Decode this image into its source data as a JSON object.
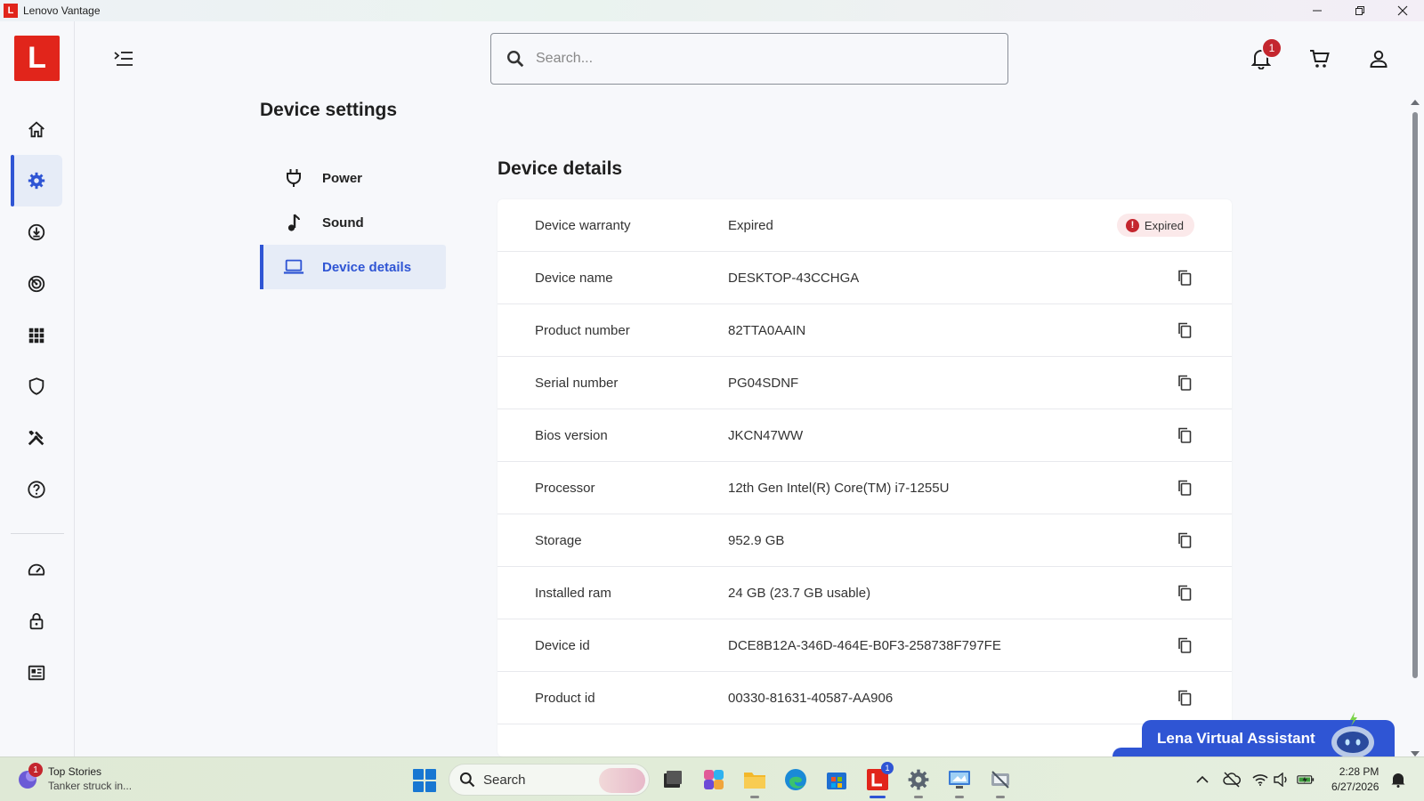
{
  "window": {
    "title": "Lenovo Vantage",
    "logo_letter": "L",
    "controls": [
      "minimize",
      "restore",
      "close"
    ]
  },
  "rail": {
    "brand_letter": "L",
    "items": [
      {
        "name": "home",
        "icon": "home-icon"
      },
      {
        "name": "device-settings",
        "icon": "gear-icon",
        "active": true
      },
      {
        "name": "system-update",
        "icon": "download-icon"
      },
      {
        "name": "smart-performance",
        "icon": "radar-icon"
      },
      {
        "name": "apps",
        "icon": "grid-icon"
      },
      {
        "name": "security",
        "icon": "shield-icon"
      },
      {
        "name": "tools",
        "icon": "tools-icon"
      },
      {
        "name": "help",
        "icon": "question-icon"
      },
      {
        "name": "dashboard",
        "icon": "speedometer-icon"
      },
      {
        "name": "privacy",
        "icon": "lock-icon"
      },
      {
        "name": "news",
        "icon": "news-icon"
      }
    ]
  },
  "header": {
    "search_placeholder": "Search...",
    "notification_count": "1"
  },
  "settings": {
    "title": "Device settings",
    "menu": [
      {
        "label": "Power",
        "icon": "plug-icon"
      },
      {
        "label": "Sound",
        "icon": "music-note-icon"
      },
      {
        "label": "Device details",
        "icon": "laptop-icon",
        "active": true
      }
    ]
  },
  "details": {
    "title": "Device details",
    "warranty": {
      "label": "Device warranty",
      "value": "Expired",
      "badge": "Expired"
    },
    "rows": [
      {
        "label": "Device name",
        "value": "DESKTOP-43CCHGA"
      },
      {
        "label": "Product number",
        "value": "82TTA0AAIN"
      },
      {
        "label": "Serial number",
        "value": "PG04SDNF"
      },
      {
        "label": "Bios version",
        "value": "JKCN47WW"
      },
      {
        "label": "Processor",
        "value": "12th Gen Intel(R) Core(TM) i7-1255U"
      },
      {
        "label": "Storage",
        "value": "952.9 GB"
      },
      {
        "label": "Installed ram",
        "value": "24 GB (23.7 GB usable)"
      },
      {
        "label": "Device id",
        "value": "DCE8B12A-346D-464E-B0F3-258738F797FE"
      },
      {
        "label": "Product id",
        "value": "00330-81631-40587-AA906"
      }
    ]
  },
  "assistant": {
    "label": "Lena Virtual Assistant"
  },
  "taskbar": {
    "news_title": "Top Stories",
    "news_sub": "Tanker struck in...",
    "news_badge": "1",
    "search_label": "Search",
    "vantage_badge": "1",
    "time": "2:28 PM",
    "date": "6/27/2026"
  },
  "colors": {
    "brand_red": "#e1251b",
    "accent_blue": "#2f55d4",
    "alert_red": "#c4262e"
  }
}
